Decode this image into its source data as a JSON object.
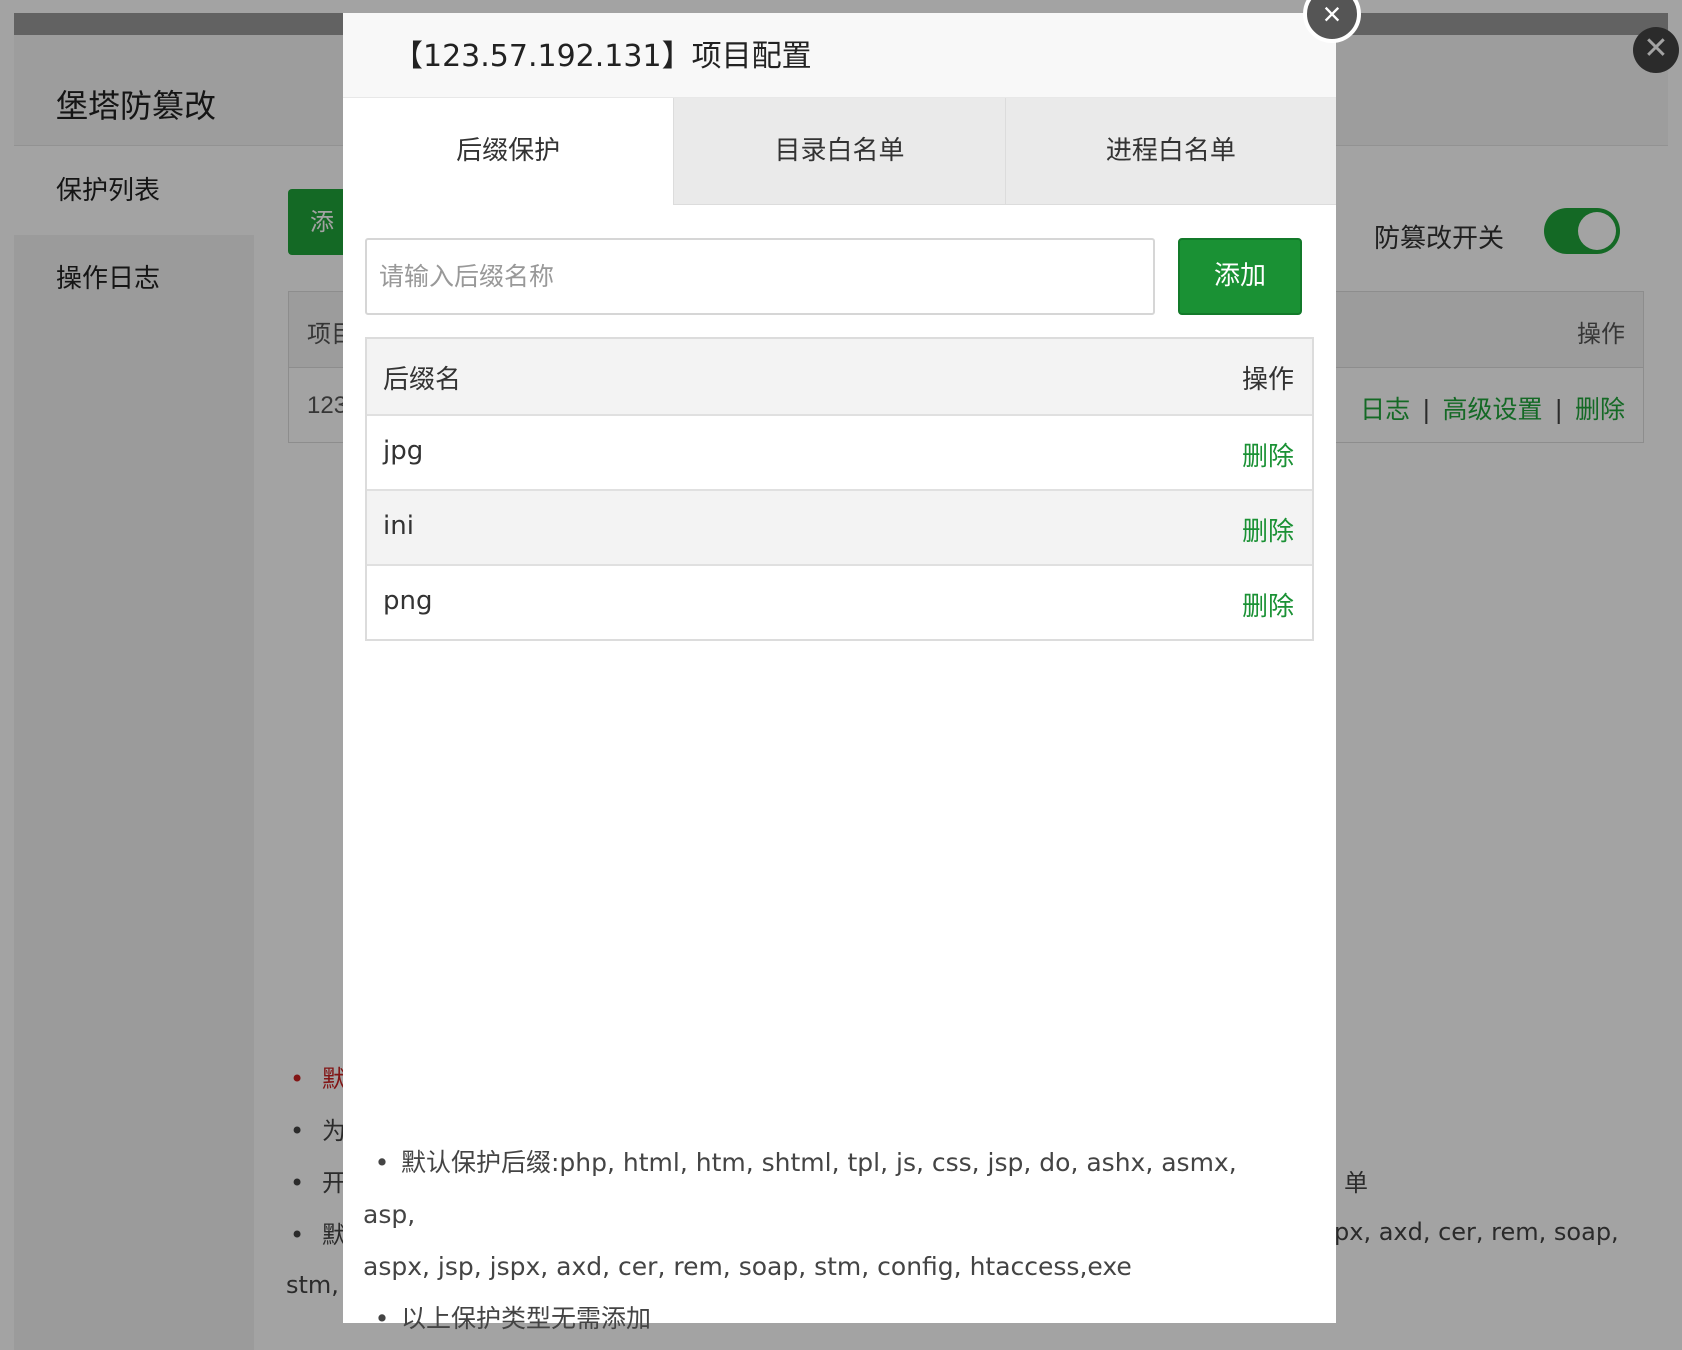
{
  "background": {
    "title": "堡塔防篡改",
    "sidebar": [
      {
        "label": "保护列表",
        "active": true
      },
      {
        "label": "操作日志",
        "active": false
      }
    ],
    "add_button_label": "添",
    "switch": {
      "label": "防篡改开关",
      "on": true
    },
    "table": {
      "header_first": "项目",
      "header_op": "操作",
      "row_first": "123",
      "ops": [
        "日志",
        "高级设置",
        "删除"
      ],
      "sep": "|"
    },
    "notes": [
      {
        "text": "默",
        "red": true
      },
      {
        "text": "为",
        "red": false
      },
      {
        "text": "开",
        "red": false
      },
      {
        "text": "默",
        "red": false
      }
    ],
    "note_right_1": "单",
    "note_right_2": "px, axd, cer, rem, soap,",
    "note_wrap": "stm,"
  },
  "modal": {
    "title": "【123.57.192.131】项目配置",
    "close": "×",
    "tabs": [
      {
        "label": "后缀保护",
        "active": true
      },
      {
        "label": "目录白名单",
        "active": false
      },
      {
        "label": "进程白名单",
        "active": false
      }
    ],
    "input": {
      "placeholder": "请输入后缀名称",
      "value": ""
    },
    "add_label": "添加",
    "table": {
      "header": {
        "name": "后缀名",
        "op": "操作"
      },
      "rows": [
        {
          "name": "jpg",
          "op": "删除"
        },
        {
          "name": "ini",
          "op": "删除"
        },
        {
          "name": "png",
          "op": "删除"
        }
      ]
    },
    "notes": [
      {
        "line1": "默认保护后缀:php, html, htm, shtml, tpl, js, css, jsp, do, ashx, asmx, asp,",
        "line2": "aspx, jsp, jspx, axd, cer, rem, soap, stm, config, htaccess,exe"
      },
      {
        "line1": "以上保护类型无需添加"
      }
    ]
  },
  "colors": {
    "accent": "#20a53a",
    "button": "#1a9134",
    "danger_note": "#cc2222"
  }
}
